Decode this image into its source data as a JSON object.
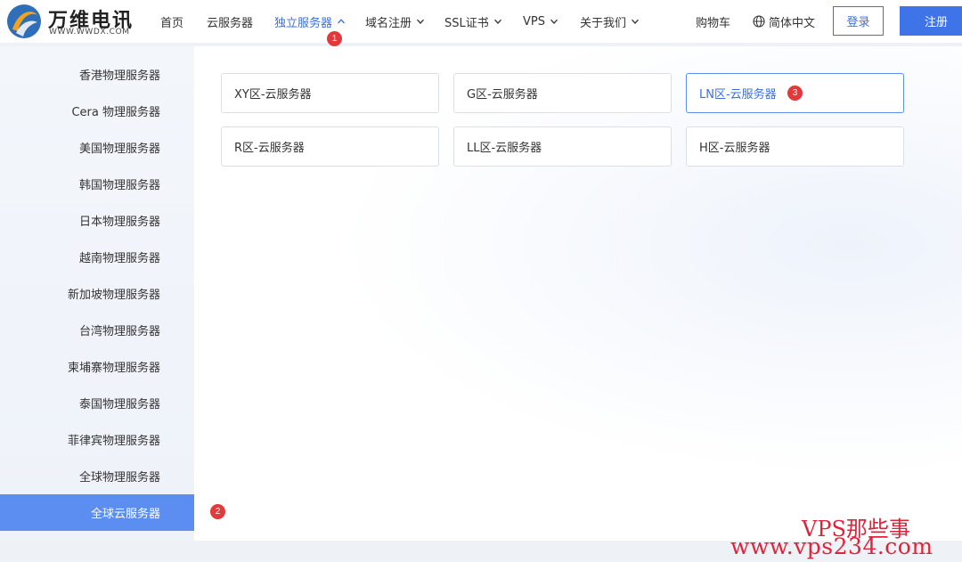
{
  "brand": {
    "name_cn": "万维电讯",
    "name_en": "WWW.WWDX.COM"
  },
  "nav": {
    "items": [
      {
        "label": "首页",
        "has_chevron": false
      },
      {
        "label": "云服务器",
        "has_chevron": false
      },
      {
        "label": "独立服务器",
        "has_chevron": true,
        "chevron": "chevron-up-icon",
        "active": true
      },
      {
        "label": "域名注册",
        "has_chevron": true,
        "chevron": "chevron-down-icon"
      },
      {
        "label": "SSL证书",
        "has_chevron": true,
        "chevron": "chevron-down-icon"
      },
      {
        "label": "VPS",
        "has_chevron": true,
        "chevron": "chevron-down-icon"
      },
      {
        "label": "关于我们",
        "has_chevron": true,
        "chevron": "chevron-down-icon"
      }
    ],
    "cart": "购物车",
    "language": "简体中文",
    "login": "登录",
    "register": "注册"
  },
  "badges": {
    "one": "1",
    "two": "2",
    "three": "3"
  },
  "sidebar": {
    "items": [
      {
        "label": "香港物理服务器"
      },
      {
        "label": "Cera 物理服务器"
      },
      {
        "label": "美国物理服务器"
      },
      {
        "label": "韩国物理服务器"
      },
      {
        "label": "日本物理服务器"
      },
      {
        "label": "越南物理服务器"
      },
      {
        "label": "新加坡物理服务器"
      },
      {
        "label": "台湾物理服务器"
      },
      {
        "label": "柬埔寨物理服务器"
      },
      {
        "label": "泰国物理服务器"
      },
      {
        "label": "菲律宾物理服务器"
      },
      {
        "label": "全球物理服务器"
      },
      {
        "label": "全球云服务器",
        "active": true
      }
    ]
  },
  "cards": [
    {
      "label": "XY区-云服务器"
    },
    {
      "label": "G区-云服务器"
    },
    {
      "label": "LN区-云服务器",
      "active": true
    },
    {
      "label": "R区-云服务器"
    },
    {
      "label": "LL区-云服务器"
    },
    {
      "label": "H区-云服务器"
    }
  ],
  "watermark": {
    "top": "VPS那些事",
    "bottom": "www.vps234.com"
  },
  "colors": {
    "accent": "#3b6fe0",
    "sidebar_active": "#5b8ef0",
    "badge": "#e5383b",
    "watermark": "#e0233b"
  }
}
